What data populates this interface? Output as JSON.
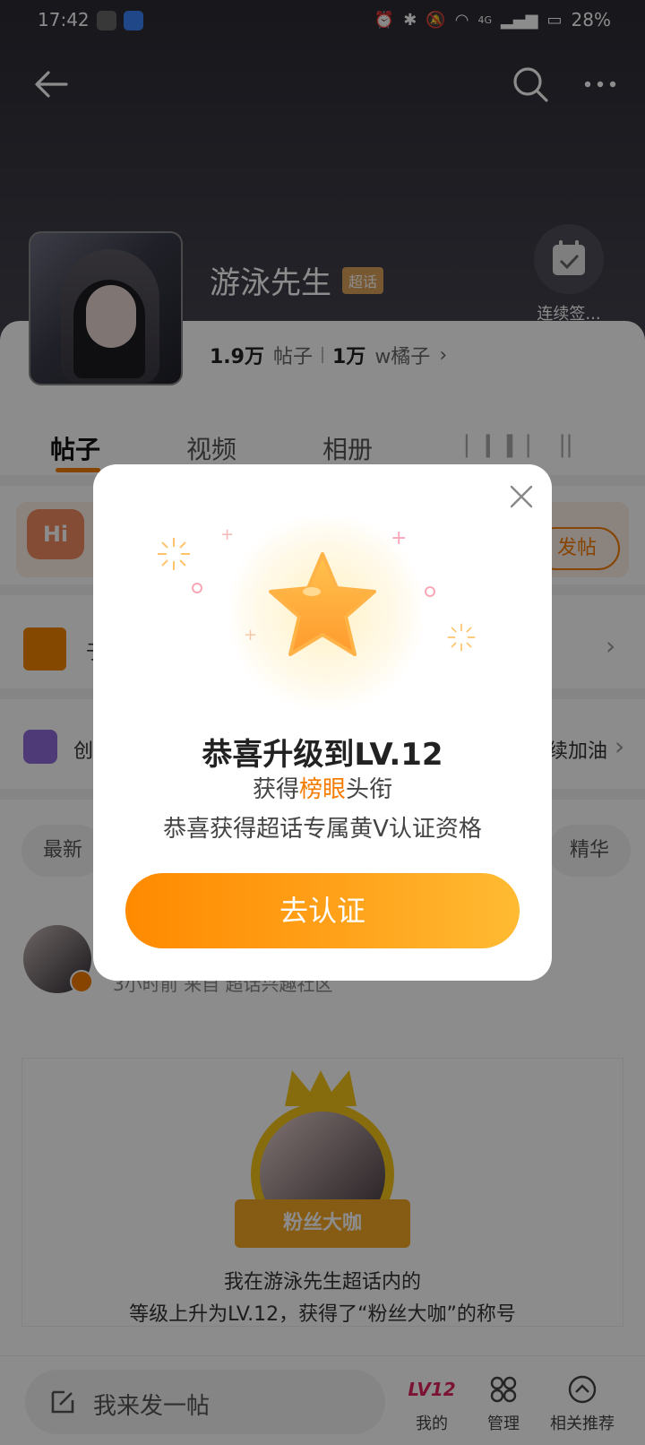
{
  "status_bar": {
    "time": "17:42",
    "battery": "28%",
    "network": "4G"
  },
  "topic": {
    "title": "游泳先生",
    "tag": "超话",
    "checkin_label": "连续签..."
  },
  "stats": {
    "posts_count": "1.9万",
    "posts_label": "帖子",
    "fans_count": "1万",
    "fans_label": "w橘子",
    "fans_chevron": "›"
  },
  "tabs": [
    {
      "label": "帖子",
      "active": true
    },
    {
      "label": "视频",
      "active": false
    },
    {
      "label": "相册",
      "active": false
    }
  ],
  "background_rows": {
    "post_button": "发帖",
    "row1_text": "于",
    "row2_text": "创",
    "row2_right": "续加油",
    "filter_left": "最新",
    "filter_right": "精华",
    "chevron": "›"
  },
  "post": {
    "meta": "3小时前  来自 超话兴趣社区",
    "ribbon": "粉丝大咖",
    "line1": "我在游泳先生超话内的",
    "line2": "等级上升为LV.12，获得了“粉丝大咖”的称号"
  },
  "bottom_bar": {
    "compose_placeholder": "我来发一帖",
    "items": [
      {
        "label": "我的",
        "icon": "lv12-icon",
        "badge": "LV12"
      },
      {
        "label": "管理",
        "icon": "grid-icon"
      },
      {
        "label": "相关推荐",
        "icon": "chevron-up-circle-icon"
      }
    ]
  },
  "dialog": {
    "title": "恭喜升级到LV.12",
    "subtitle_prefix": "获得",
    "subtitle_highlight": "榜眼",
    "subtitle_suffix": "头衔",
    "line2": "恭喜获得超话专属黄V认证资格",
    "button": "去认证"
  },
  "colors": {
    "accent": "#f57c00",
    "overlay": "rgba(0,0,0,0.45)",
    "button_start": "#ff8a00",
    "button_end": "#ffbb33"
  }
}
